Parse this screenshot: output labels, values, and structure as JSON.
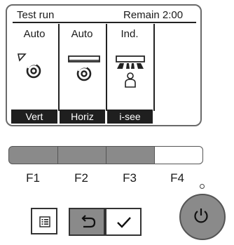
{
  "screen": {
    "title": "Test run",
    "remain": "Remain 2:00",
    "modes": [
      {
        "label": "Auto",
        "icon": "vane-up-down-swing-icon"
      },
      {
        "label": "Auto",
        "icon": "vane-left-right-swing-icon"
      },
      {
        "label": "Ind.",
        "icon": "i-see-sensor-person-icon"
      }
    ],
    "functions": [
      "Vert",
      "Horiz",
      "i-see",
      ""
    ]
  },
  "keys": {
    "labels": [
      "F1",
      "F2",
      "F3",
      "F4"
    ],
    "states": [
      "active",
      "active",
      "active",
      "inactive"
    ]
  },
  "buttons": {
    "menu_icon": "menu-icon",
    "return_icon": "return-icon",
    "confirm_icon": "check-icon",
    "power_icon": "power-icon"
  },
  "colors": {
    "key_active": "#8a8a8a",
    "function_bar": "#1f1f1f"
  }
}
